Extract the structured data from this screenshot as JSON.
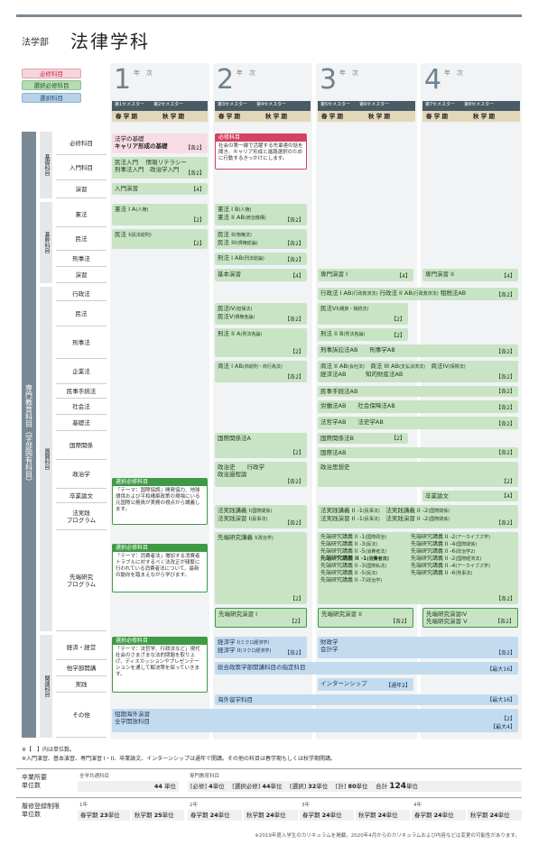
{
  "header": {
    "faculty": "法学部",
    "department": "法律学科"
  },
  "legend": {
    "required": "必修科目",
    "selective_required": "選択必修科目",
    "elective": "選択科目"
  },
  "years": [
    {
      "num": "1",
      "label": "年　次",
      "sem1": "第1セメスター",
      "sem2": "第2セメスター"
    },
    {
      "num": "2",
      "label": "年　次",
      "sem1": "第3セメスター",
      "sem2": "第4セメスター"
    },
    {
      "num": "3",
      "label": "年　次",
      "sem1": "第5セメスター",
      "sem2": "第6セメスター"
    },
    {
      "num": "4",
      "label": "年　次",
      "sem1": "第7セメスター",
      "sem2": "第8セメスター"
    }
  ],
  "season": {
    "spring": "春 学 期",
    "autumn": "秋 学 期"
  },
  "categories": {
    "specialized": "専門教育科目（学部固有科目）",
    "basic": "基礎科目",
    "core": "基幹科目",
    "development": "展開科目",
    "related": "関連科目"
  },
  "rows": {
    "required": "必修科目",
    "intro": "入門科目",
    "seminar": "演習",
    "constitution": "憲法",
    "civil": "民法",
    "criminal": "刑事法",
    "seminar2": "演習",
    "admin": "行政法",
    "civil2": "民法",
    "criminal2": "刑事法",
    "corporate": "企業法",
    "civproc": "民事手続法",
    "social": "社会法",
    "basiclaw": "基礎法",
    "intl": "国際関係",
    "politics": "政治学",
    "thesis": "卒業論文",
    "practice": "法実践\nプログラム",
    "advanced": "先端研究\nプログラム",
    "economics": "経済・経営",
    "otherdept": "他学部開講",
    "practical": "実践",
    "others": "その他"
  },
  "courses": {
    "y1_basic": "法学の基礎",
    "y1_career": "キャリア形成の基礎",
    "y1_career_cr": "【各2】",
    "req_box_title": "必修科目",
    "req_box_text": "社会の第一線で活躍する先輩達の話を聞き、キャリア形成と進路選択のために行動するきっかけにします。",
    "y1_intro1": "民法入門　 情報リテラシー",
    "y1_intro2": "刑事法入門　政治学入門",
    "y1_intro_cr": "【各2】",
    "y1_seminar": "入門演習",
    "y1_seminar_cr": "【4】",
    "y1_const": "憲法 I A",
    "y1_const_s": "(人権)",
    "cr2": "【2】",
    "y2_const1": "憲法 I B",
    "y2_const1_s": "(人権)",
    "y2_const2": "憲法 II AB",
    "y2_const2_s": "(統治機構)",
    "cre2": "【各2】",
    "y1_civil": "民法 I",
    "y1_civil_s": "(民法総則)",
    "y2_civil1": "民法 II",
    "y2_civil1_s": "(物権法)",
    "y2_civil2": "民法 III",
    "y2_civil2_s": "(債権総論)",
    "y2_crim": "刑法 I AB",
    "y2_crim_s": "(刑法総論)",
    "y2_basicsem": "基本演習",
    "cr4": "【4】",
    "y3_sem": "専門演習 I",
    "y4_sem": "専門演習 II",
    "y3_admin1": "行政法 I AB",
    "y3_admin1_s": "(行政救済法)",
    "y3_admin2": "行政法 II AB",
    "y3_admin2_s": "(行政救済法)",
    "y3_tax": "租税法AB",
    "y2_civil4": "民法IV",
    "y2_civil4_s": "(担保法)",
    "y2_civil5": "民法V",
    "y2_civil5_s": "(債権各論)",
    "y3_civil6": "民法VI",
    "y3_civil6_s": "(親族・相続法)",
    "y2_crim2": "刑法 II A",
    "y2_crim2_s": "(刑法各論)",
    "y3_crim2b": "刑法 II B",
    "y3_crim2b_s": "(刑法各論)",
    "y3_crimproc": "刑事訴訟法AB　　刑事学AB",
    "y2_corp": "商法 I AB",
    "y2_corp_s": "(商総則・商行為法)",
    "y3_corp2": "商法 II AB",
    "y3_corp2_s": "(会社法)",
    "y3_corp3": "商法 III AB",
    "y3_corp3_s": "(支払決済法)",
    "y3_corp4": "商法IV",
    "y3_corp4_s": "(保険法)",
    "y3_econlaw": "経済法AB　　　 知的財産法AB",
    "y3_civproc": "民事手続法AB",
    "y3_labor": "労働法AB　　社会保障法AB",
    "y3_philo": "法哲学AB　　法史学AB",
    "y2_intl": "国際関係法A",
    "y3_intl": "国際関係法B",
    "y3_intlecon": "国際法AB",
    "y2_pol1": "政治史　　行政学",
    "y2_pol2": "政治過程論",
    "y3_polthought": "政治思想史",
    "y4_thesis": "卒業論文",
    "sreq1_title": "選択必修科目",
    "sreq1_text": "「テーマ：国際協調」開発協力、地球環境および平和構築政策の現場にいる元国際公務員が実務の視点から講義します。",
    "y2_prac1": "法実践講義 I",
    "y2_prac1_s": "(国際関係)",
    "y2_prac2": "法実践演習 I",
    "y2_prac2_s": "(民事法)",
    "y3_prac1": "法実践講義 II -1",
    "y3_prac1_s": "(民事法)",
    "y3_prac2": "法実践講義 II -2",
    "y3_prac2_s": "(国際関係)",
    "y3_prac3": "法実践演習 II -1",
    "y3_prac3_s": "(民事法)",
    "y3_prac4": "法実践演習 II -2",
    "y3_prac4_s": "(国際関係)",
    "sreq2_title": "選択必修科目",
    "sreq2_text": "「テーマ：消費者法」増加する消費者トラブルに対するべく法改正が頻繁に行われている消費者法について、最新の動向を踏まえながら学びます。",
    "y2_adv": "先端研究講義 I",
    "y2_adv_s": "(政治学)",
    "adv_list_l": [
      "先端研究講義 II -1",
      "先端研究講義 II -3",
      "先端研究講義 II -5",
      "先端研究講義 II -1",
      "先端研究講義 II -3",
      "先端研究講義 II -5",
      "先端研究講義 II -7"
    ],
    "adv_list_ls": [
      "(国際政治)",
      "(民法)",
      "(消費者法)",
      "(消費者法)",
      "(国際私法)",
      "(民法)",
      "(政治学)"
    ],
    "adv_list_r": [
      "先端研究講義 II -2",
      "先端研究講義 II -4",
      "先端研究講義 II -6",
      "先端研究講義 II -2",
      "先端研究講義 II -4",
      "先端研究講義 II -6"
    ],
    "adv_list_rs": [
      "(アーカイブズ学)",
      "(国際関係)",
      "(政治学2)",
      "(国際経済法)",
      "(アーカイブズ学)",
      "(刑事法)"
    ],
    "y2_advsem": "先端研究演習 I",
    "y3_advsem": "先端研究演習 II",
    "y4_advsem1": "先端研究演習IV",
    "y4_advsem2": "先端研究演習 V",
    "sreq3_title": "選択必修科目",
    "sreq3_text": "「テーマ：法哲学、行政法など」現代社会のさまざまな法的問題を取り上げ、ディスカッションやプレゼンテーションを通して解決策を探っていきます。",
    "y2_econ1": "経済学 I",
    "y2_econ1_s": "(ミクロ経済学)",
    "y2_econ2": "経済学 II",
    "y2_econ2_s": "(マクロ経済学)",
    "y3_fin": "財政学",
    "y3_acc": "会計学",
    "y2_otherdept": "総合政策学部開講科目の指定科目",
    "cr_multi": "【最大16】",
    "y3_intern": "インターンシップ",
    "y3_intern_cr": "【通年2】",
    "y2_abroad": "海外留学科目",
    "y1_short": "短期海外演習",
    "y1_global": "全学開放科目",
    "cr_max4": "【最大4】"
  },
  "notes": [
    "※【　】内は単位数。",
    "※入門演習、基本演習、専門演習 I・II、卒業論文、インターンシップは通年で開講。その他の科目は春学期もしくは秋学期開講。"
  ],
  "summary": {
    "grad_label": "卒業所要\n単位数",
    "common_label": "全学共通科目",
    "common_val": "44",
    "unit": "単位",
    "spec_label": "専門教育科目",
    "req_l": "[必修]",
    "req_v": "4",
    "sreq_l": "[選択必修]",
    "sreq_v": "44",
    "sel_l": "[選択]",
    "sel_v": "32",
    "tot_l": "[計]",
    "tot_v": "80",
    "grand_l": "合計",
    "grand_v": "124",
    "limit_label": "履修登録制限\n単位数",
    "y1": "1年",
    "y2": "2年",
    "y3": "3年",
    "y4": "4年",
    "spring": "春学期",
    "autumn": "秋学期",
    "lim": [
      "23",
      "25",
      "24",
      "24",
      "24",
      "24",
      "24",
      "24"
    ]
  },
  "footer": "※2019年度入学生のカリキュラムを掲載。2020年4月からのカリキュラムおよび内容などは変更の可能性があります。"
}
